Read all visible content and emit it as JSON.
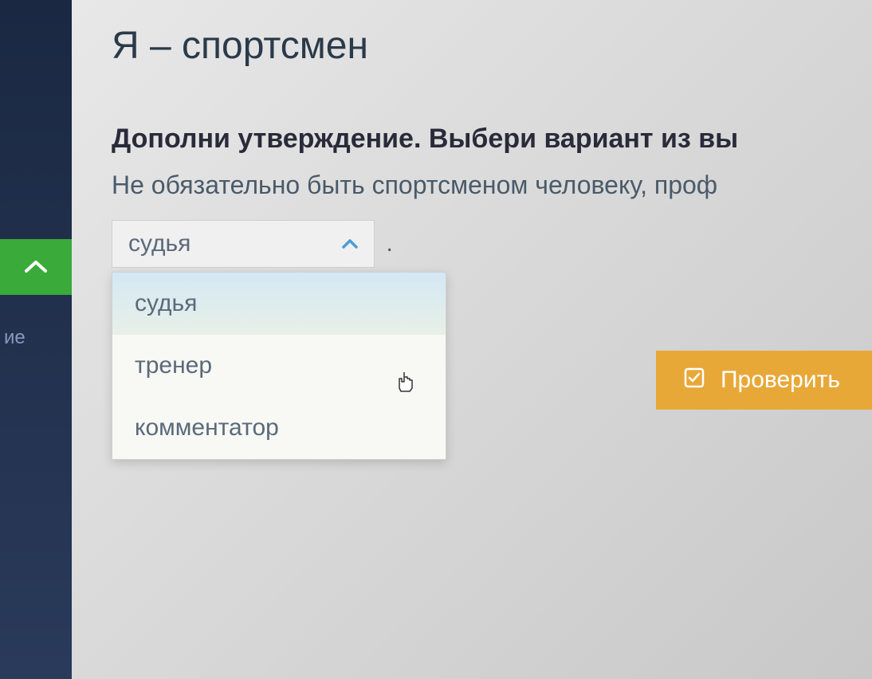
{
  "sidebar": {
    "partial_label": "ие"
  },
  "page": {
    "title": "Я – спортсмен",
    "instruction_bold": "Дополни утверждение. Выбери вариант из вы",
    "instruction_text": "Не обязательно быть спортсменом человеку, проф"
  },
  "dropdown": {
    "selected": "судья",
    "options": [
      "судья",
      "тренер",
      "комментатор"
    ],
    "period": "."
  },
  "button": {
    "check_label": "Проверить"
  }
}
